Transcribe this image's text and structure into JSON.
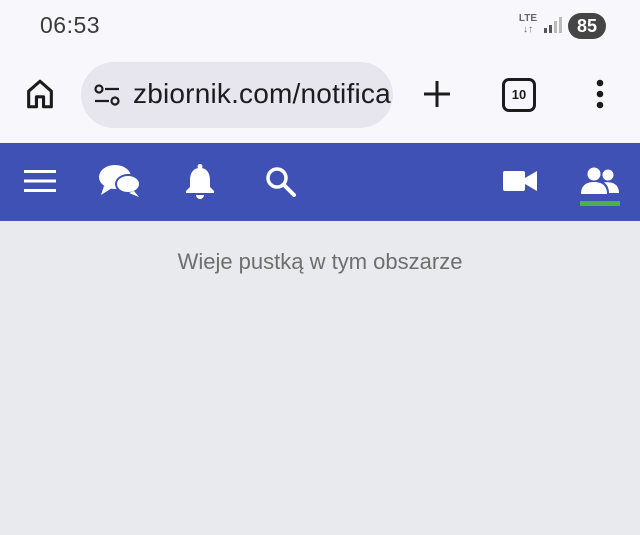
{
  "status": {
    "time": "06:53",
    "network": "LTE",
    "battery": "85"
  },
  "browser": {
    "url": "zbiornik.com/notifica",
    "tab_count": "10",
    "icons": [
      "home-icon",
      "tune-icon",
      "plus-icon",
      "tabs-icon",
      "more-vert-icon"
    ]
  },
  "app_nav": {
    "background": "#3f51b5",
    "active_indicator_color": "#4caf50",
    "items": [
      "menu-icon",
      "chat-icon",
      "bell-icon",
      "search-icon",
      "video-icon",
      "people-icon"
    ],
    "active_item": "people-icon"
  },
  "content": {
    "empty_message": "Wieje pustką w tym obszarze"
  }
}
